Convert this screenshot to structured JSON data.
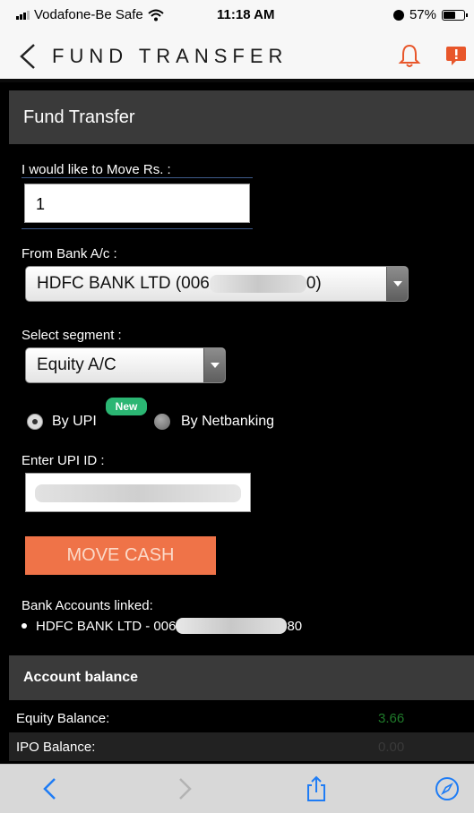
{
  "status_bar": {
    "carrier": "Vodafone-Be Safe",
    "time": "11:18 AM",
    "battery": "57%",
    "battery_level": 0.57
  },
  "header": {
    "title": "FUND TRANSFER",
    "back_icon": "chevron-left-icon",
    "bell_icon": "bell-icon",
    "alert_icon": "alert-icon",
    "accent_color": "#e8562a"
  },
  "section": {
    "title": "Fund Transfer"
  },
  "form": {
    "amount_label": "I would like to Move Rs. :",
    "amount_value": "1",
    "bank_label": "From Bank A/c :",
    "bank_value_prefix": "HDFC BANK LTD (006",
    "bank_value_suffix": "0)",
    "segment_label": "Select segment :",
    "segment_value": "Equity A/C",
    "payment_options": [
      {
        "label": "By UPI",
        "selected": true
      },
      {
        "label": "By Netbanking",
        "selected": false
      }
    ],
    "new_badge": "New",
    "upi_label": "Enter UPI ID :",
    "submit_label": "MOVE CASH",
    "button_color": "#ef7348"
  },
  "linked_accounts": {
    "title": "Bank Accounts linked:",
    "items": [
      {
        "prefix": "HDFC BANK LTD - 006",
        "suffix": "80"
      }
    ]
  },
  "account_balance": {
    "title": "Account balance",
    "rows": [
      {
        "label": "Equity Balance:",
        "value": "3.66",
        "value_color": "#1f7a2a"
      },
      {
        "label": "IPO Balance:",
        "value": "0.00",
        "value_color": "#3a3a3a"
      }
    ]
  },
  "safari_toolbar": {
    "icons": [
      "back-icon",
      "forward-icon",
      "share-icon",
      "compass-icon"
    ],
    "tint": "#1e7cf5"
  }
}
